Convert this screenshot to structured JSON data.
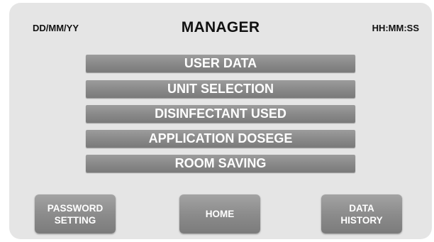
{
  "header": {
    "date": "DD/MM/YY",
    "title": "MANAGER",
    "time": "HH:MM:SS"
  },
  "menu": {
    "items": [
      {
        "label": "USER DATA"
      },
      {
        "label": "UNIT SELECTION"
      },
      {
        "label": "DISINFECTANT USED"
      },
      {
        "label": "APPLICATION DOSEGE"
      },
      {
        "label": "ROOM SAVING"
      }
    ]
  },
  "footer": {
    "password_setting": "PASSWORD\nSETTING",
    "home": "HOME",
    "data_history": "DATA\nHISTORY"
  },
  "colors": {
    "panel_background": "#e5e5e5",
    "button_gray": "#888888",
    "button_text": "#ffffff",
    "header_text": "#111111"
  }
}
